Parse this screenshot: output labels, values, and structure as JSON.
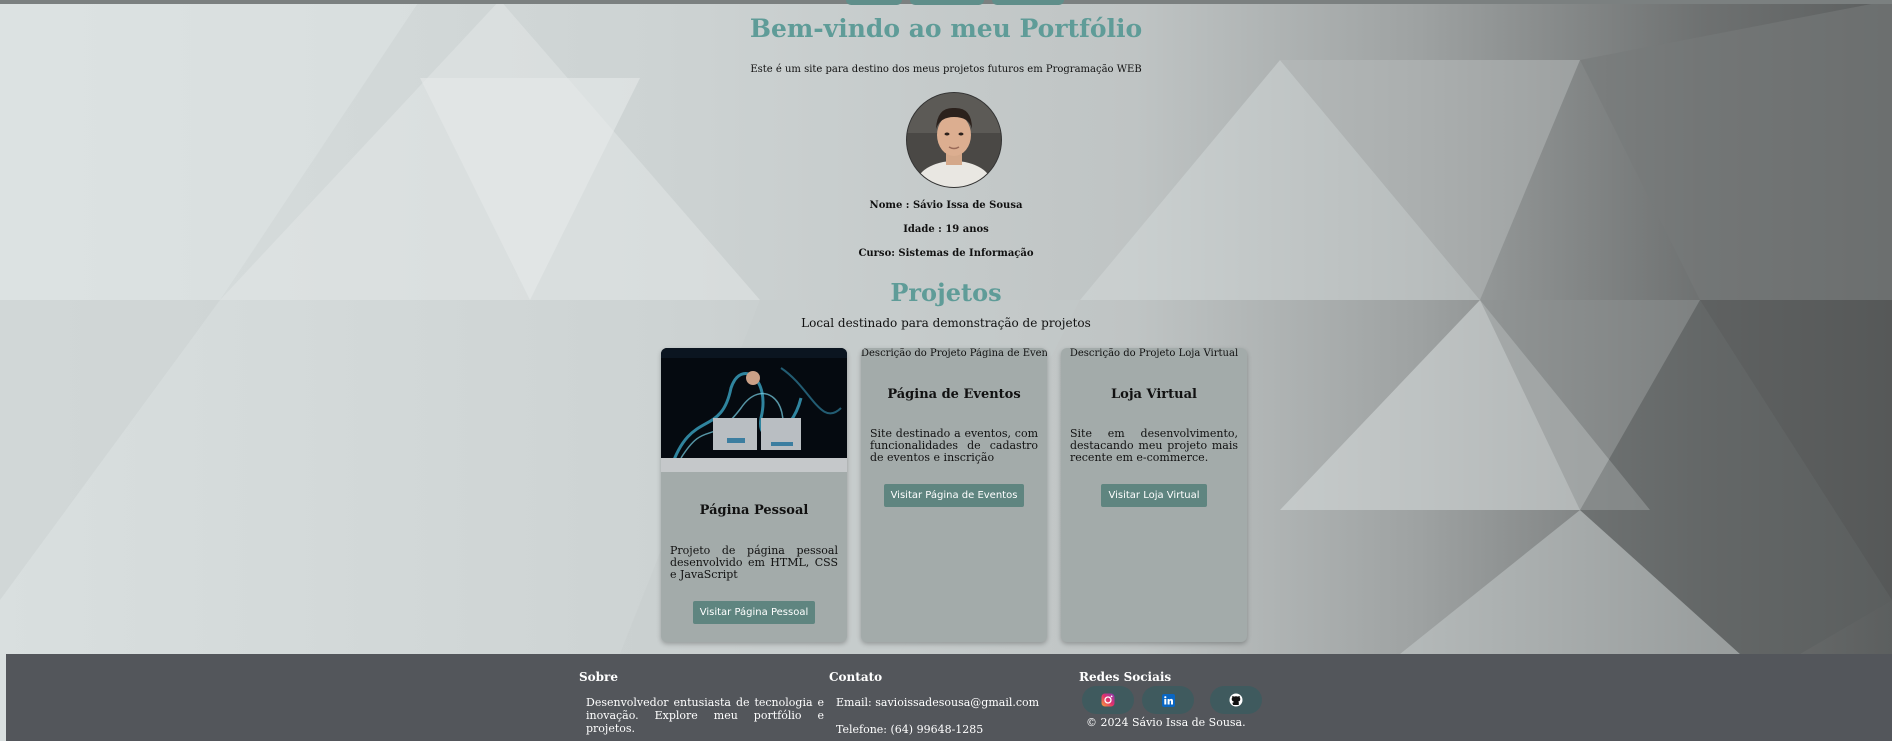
{
  "header": {
    "title": "Bem-vindo ao meu Portfólio",
    "intro": "Este é um site para destino dos meus projetos futuros em Programação WEB"
  },
  "profile": {
    "name": "Nome : Sávio Issa de Sousa",
    "age": "Idade : 19 anos",
    "course": "Curso: Sistemas de Informação"
  },
  "projects": {
    "title": "Projetos",
    "subtitle": "Local destinado para demonstração de projetos",
    "items": [
      {
        "title": "Página Pessoal",
        "description": "Projeto de página pessoal desenvolvido em HTML, CSS e JavaScript",
        "button": "Visitar Página Pessoal"
      },
      {
        "alt": "Descrição do Projeto Página de Eventos",
        "title": "Página de Eventos",
        "description": "Site destinado a eventos, com funcionalidades de cadastro de eventos e inscrição",
        "button": "Visitar Página de Eventos"
      },
      {
        "alt": "Descrição do Projeto Loja Virtual",
        "title": "Loja Virtual",
        "description": "Site em desenvolvimento, destacando meu projeto mais recente em e-commerce.",
        "button": "Visitar Loja Virtual"
      }
    ]
  },
  "footer": {
    "about_title": "Sobre",
    "about_text": "Desenvolvedor entusiasta de tecnologia e inovação. Explore meu portfólio e projetos.",
    "contact_title": "Contato",
    "email": "Email: savioissadesousa@gmail.com",
    "phone": "Telefone: (64) 99648-1285",
    "social_title": "Redes Sociais",
    "copyright": "© 2024 Sávio Issa de Sousa.",
    "social_icons": [
      "instagram-icon",
      "linkedin-icon",
      "github-icon"
    ]
  },
  "colors": {
    "accent": "#5f9c98",
    "button": "#5f8580",
    "card": "#a3abaa",
    "footer": "#53565b"
  }
}
